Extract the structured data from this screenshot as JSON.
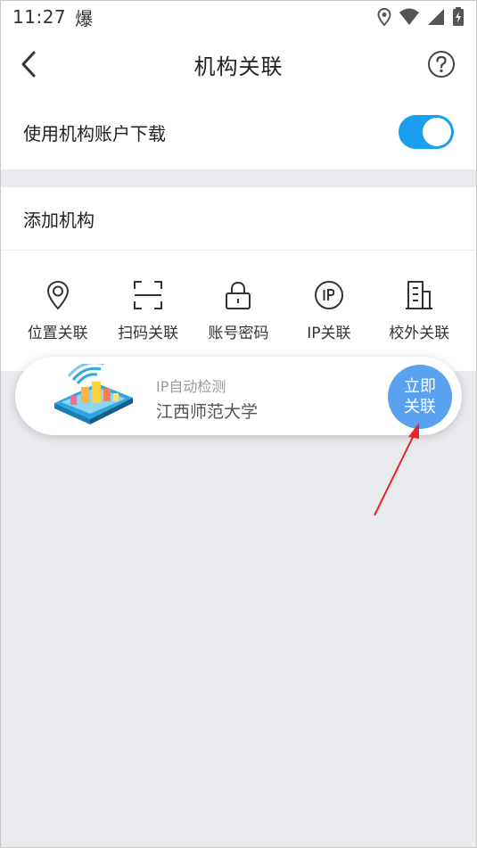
{
  "status_bar": {
    "time": "11:27",
    "app_glyph": "爆"
  },
  "header": {
    "title": "机构关联"
  },
  "toggle_row": {
    "label": "使用机构账户下载",
    "enabled": true,
    "accent": "#1a9ef0"
  },
  "add_section": {
    "title": "添加机构",
    "methods": [
      {
        "label": "位置关联",
        "icon": "location-pin-icon"
      },
      {
        "label": "扫码关联",
        "icon": "scan-frame-icon"
      },
      {
        "label": "账号密码",
        "icon": "lock-icon"
      },
      {
        "label": "IP关联",
        "icon": "ip-circle-icon"
      },
      {
        "label": "校外关联",
        "icon": "building-icon"
      }
    ]
  },
  "popup": {
    "detect_label": "IP自动检测",
    "institution": "江西师范大学",
    "button_line1": "立即",
    "button_line2": "关联",
    "button_color": "#5aa2f0"
  }
}
